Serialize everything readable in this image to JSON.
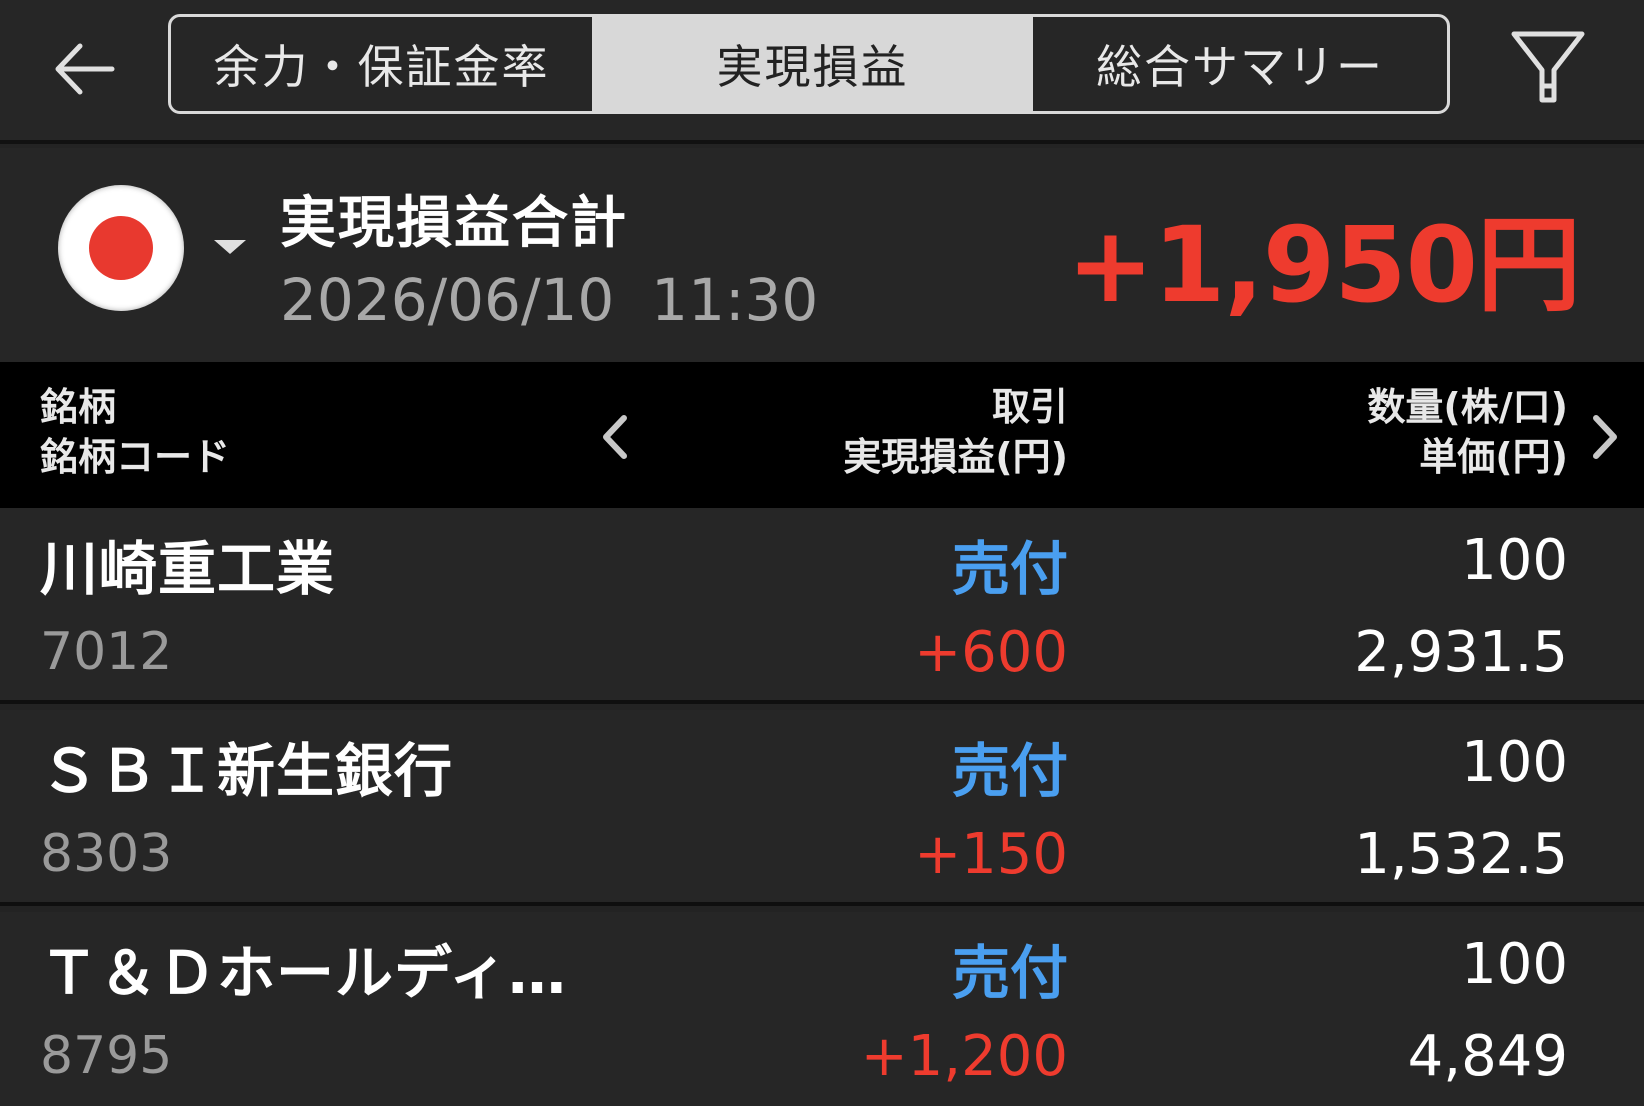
{
  "tabs": [
    {
      "label": "余力・保証金率",
      "active": false
    },
    {
      "label": "実現損益",
      "active": true
    },
    {
      "label": "総合サマリー",
      "active": false
    }
  ],
  "icons": {
    "back": "back-arrow-icon",
    "filter": "filter-icon",
    "flag": "japan-flag-icon",
    "prev": "chevron-left-icon",
    "next": "chevron-right-icon"
  },
  "summary": {
    "title": "実現損益合計",
    "datetime": "2026/06/10  11:30",
    "total": "+1,950円"
  },
  "columns": {
    "col1_line1": "銘柄",
    "col1_line2": "銘柄コード",
    "col2_line1": "取引",
    "col2_line2": "実現損益(円)",
    "col3_line1": "数量(株/口)",
    "col3_line2": "単価(円)"
  },
  "rows": [
    {
      "name": "川崎重工業",
      "code": "7012",
      "trade": "売付",
      "pl": "+600",
      "qty": "100",
      "price": "2,931.5"
    },
    {
      "name": "ＳＢＩ新生銀行",
      "code": "8303",
      "trade": "売付",
      "pl": "+150",
      "qty": "100",
      "price": "1,532.5"
    },
    {
      "name": "Ｔ＆Ｄホールディ…",
      "code": "8795",
      "trade": "売付",
      "pl": "+1,200",
      "qty": "100",
      "price": "4,849"
    }
  ],
  "colors": {
    "positive": "#ee3b2e",
    "sell": "#4a9ff0",
    "background": "#232323",
    "header": "#000000"
  }
}
